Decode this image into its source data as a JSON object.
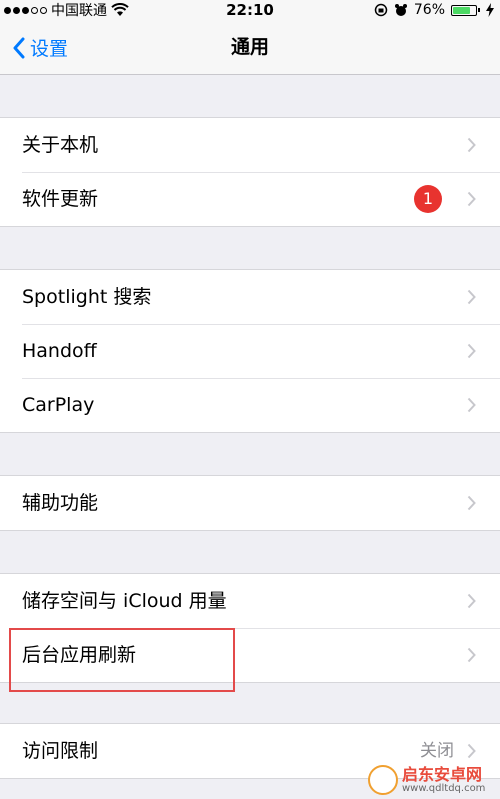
{
  "status_bar": {
    "carrier": "中国联通",
    "time": "22:10",
    "battery_percent": "76%",
    "battery_level": 0.76
  },
  "nav": {
    "back_label": "设置",
    "title": "通用"
  },
  "groups": [
    {
      "items": [
        {
          "label": "关于本机"
        },
        {
          "label": "软件更新",
          "badge": "1"
        }
      ]
    },
    {
      "items": [
        {
          "label": "Spotlight 搜索"
        },
        {
          "label": "Handoff"
        },
        {
          "label": "CarPlay"
        }
      ]
    },
    {
      "items": [
        {
          "label": "辅助功能"
        }
      ]
    },
    {
      "items": [
        {
          "label": "储存空间与 iCloud 用量"
        },
        {
          "label": "后台应用刷新"
        }
      ]
    },
    {
      "items": [
        {
          "label": "访问限制",
          "value": "关闭"
        }
      ]
    }
  ],
  "watermark": {
    "title": "启东安卓网",
    "url": "www.qdltdq.com"
  },
  "colors": {
    "accent": "#007aff",
    "badge": "#e8332f",
    "highlight_box": "#e34a4a",
    "battery": "#4cd964"
  }
}
